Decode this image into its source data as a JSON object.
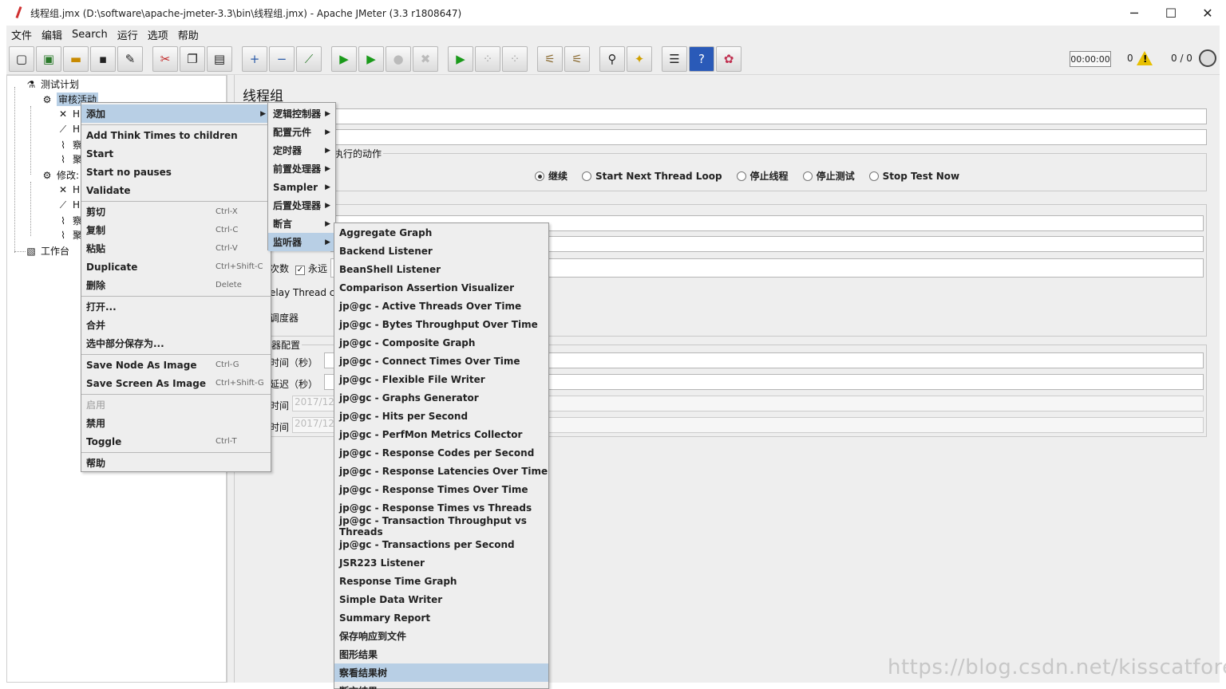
{
  "window": {
    "title": "线程组.jmx (D:\\software\\apache-jmeter-3.3\\bin\\线程组.jmx) - Apache JMeter (3.3 r1808647)",
    "minimize": "─",
    "maximize": "☐",
    "close": "✕"
  },
  "menubar": [
    "文件",
    "编辑",
    "Search",
    "运行",
    "选项",
    "帮助"
  ],
  "toolbar": {
    "timer": "00:00:00",
    "error_count": "0",
    "threads": "0 / 0",
    "icons": [
      "new-icon",
      "templates-icon",
      "open-icon",
      "save-icon",
      "save-as-icon",
      "cut-icon",
      "copy-icon",
      "paste-icon",
      "expand-icon",
      "collapse-icon",
      "toggle-icon",
      "start-icon",
      "start-no-pause-icon",
      "stop-icon",
      "shutdown-icon",
      "remote-start-icon",
      "remote-stop-icon",
      "remote-shutdown-icon",
      "clear-icon",
      "clear-all-icon",
      "search-icon",
      "reset-search-icon",
      "function-helper-icon",
      "help-icon",
      "log-viewer-icon"
    ]
  },
  "tree": {
    "root": "测试计划",
    "group1": "审核活动",
    "group1_children": [
      "H",
      "H",
      "察",
      "聚"
    ],
    "group2": "修改:",
    "group2_children": [
      "H",
      "H",
      "察",
      "聚"
    ],
    "workbench": "工作台"
  },
  "right_panel": {
    "title": "线程组",
    "action_group_label": "执行的动作",
    "radios": [
      "继续",
      "Start Next Thread Loop",
      "停止线程",
      "停止测试",
      "Stop Test Now"
    ],
    "selected_radio": "继续",
    "loop_label": "次数",
    "forever_label": "永远",
    "delay_label": "elay Thread c",
    "scheduler_label": "调度器",
    "scheduler_config_label": "器配置",
    "duration_label": "时间（秒）",
    "startup_delay_label": "延迟（秒）",
    "start_time_label": "时间",
    "end_time_label": "时间",
    "start_time_value": "2017/12/",
    "end_time_value": "2017/12/"
  },
  "context_menu": [
    {
      "label": "添加",
      "submenu": true,
      "highlight": true
    },
    {
      "sep": true
    },
    {
      "label": "Add Think Times to children"
    },
    {
      "label": "Start"
    },
    {
      "label": "Start no pauses"
    },
    {
      "label": "Validate"
    },
    {
      "sep": true
    },
    {
      "label": "剪切",
      "shortcut": "Ctrl-X"
    },
    {
      "label": "复制",
      "shortcut": "Ctrl-C"
    },
    {
      "label": "粘贴",
      "shortcut": "Ctrl-V"
    },
    {
      "label": "Duplicate",
      "shortcut": "Ctrl+Shift-C"
    },
    {
      "label": "删除",
      "shortcut": "Delete"
    },
    {
      "sep": true
    },
    {
      "label": "打开..."
    },
    {
      "label": "合并"
    },
    {
      "label": "选中部分保存为..."
    },
    {
      "sep": true
    },
    {
      "label": "Save Node As Image",
      "shortcut": "Ctrl-G"
    },
    {
      "label": "Save Screen As Image",
      "shortcut": "Ctrl+Shift-G"
    },
    {
      "sep": true
    },
    {
      "label": "启用",
      "disabled": true
    },
    {
      "label": "禁用"
    },
    {
      "label": "Toggle",
      "shortcut": "Ctrl-T"
    },
    {
      "sep": true
    },
    {
      "label": "帮助"
    }
  ],
  "add_submenu": [
    {
      "label": "逻辑控制器"
    },
    {
      "label": "配置元件"
    },
    {
      "label": "定时器"
    },
    {
      "label": "前置处理器"
    },
    {
      "label": "Sampler"
    },
    {
      "label": "后置处理器"
    },
    {
      "label": "断言"
    },
    {
      "label": "监听器",
      "highlight": true
    }
  ],
  "listener_submenu": [
    "Aggregate Graph",
    "Backend Listener",
    "BeanShell Listener",
    "Comparison Assertion Visualizer",
    "jp@gc - Active Threads Over Time",
    "jp@gc - Bytes Throughput Over Time",
    "jp@gc - Composite Graph",
    "jp@gc - Connect Times Over Time",
    "jp@gc - Flexible File Writer",
    "jp@gc - Graphs Generator",
    "jp@gc - Hits per Second",
    "jp@gc - PerfMon Metrics Collector",
    "jp@gc - Response Codes per Second",
    "jp@gc - Response Latencies Over Time",
    "jp@gc - Response Times Over Time",
    "jp@gc - Response Times vs Threads",
    "jp@gc - Transaction Throughput vs Threads",
    "jp@gc - Transactions per Second",
    "JSR223 Listener",
    "Response Time Graph",
    "Simple Data Writer",
    "Summary Report",
    "保存响应到文件",
    "图形结果",
    "察看结果树",
    "断言结果"
  ],
  "listener_highlight_index": 24,
  "watermark": "https://blog.csdn.net/kisscatforever"
}
